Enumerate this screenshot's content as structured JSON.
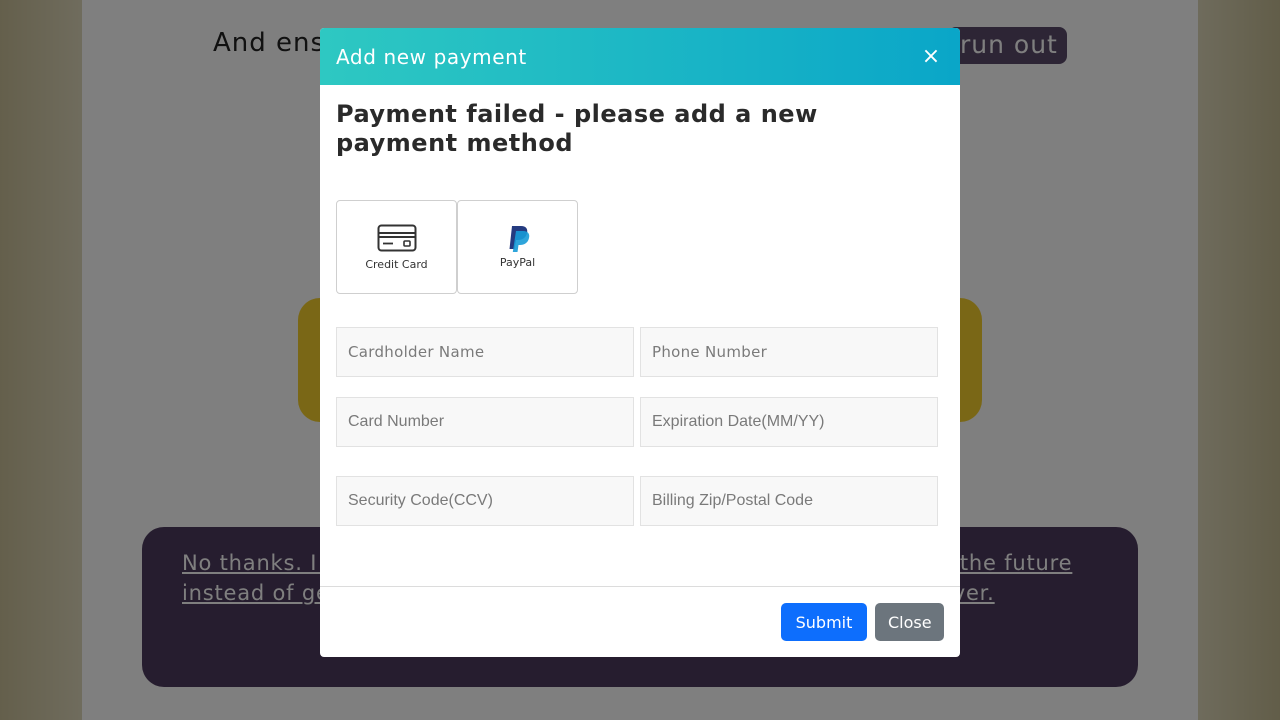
{
  "background": {
    "headline_start": "And ens",
    "pill_text": "run out",
    "decline_text": "No thanks. I u                                                                                  kay with missing out o                                                                                esium levels for achieving                                                                          e in the future instead of getting it at $15/bottle today. I'll pass on this chance forever."
  },
  "modal": {
    "title": "Add new payment",
    "close_icon": "×",
    "heading": "Payment failed - please add a new payment method",
    "methods": [
      {
        "label": "Credit Card",
        "icon": "credit-card-icon"
      },
      {
        "label": "PayPal",
        "icon": "paypal-icon"
      }
    ],
    "fields": {
      "cardholder_name": "Cardholder Name",
      "phone_number": "Phone Number",
      "card_number": "Card Number",
      "expiration": "Expiration Date(MM/YY)",
      "security_code": "Security Code(CCV)",
      "billing_zip": "Billing Zip/Postal Code"
    },
    "buttons": {
      "submit": "Submit",
      "close": "Close"
    }
  },
  "colors": {
    "header_gradient_start": "#2ec8c2",
    "header_gradient_end": "#0aa6c8",
    "submit": "#0d6efd",
    "close": "#6c757d"
  }
}
